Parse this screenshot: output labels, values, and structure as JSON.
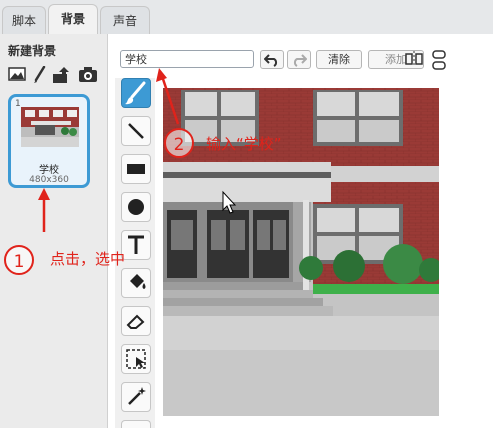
{
  "tabs": [
    {
      "label": "脚本"
    },
    {
      "label": "背景"
    },
    {
      "label": "声音"
    }
  ],
  "sidebar": {
    "new_backdrop_label": "新建背景",
    "source_icons": [
      "image-library-icon",
      "paint-brush-icon",
      "upload-icon",
      "camera-icon"
    ],
    "backdrop": {
      "index": "1",
      "name": "学校",
      "size": "480x360"
    }
  },
  "editor": {
    "name_input_value": "学校",
    "clear_label": "清除",
    "add_label": "添加",
    "toolbar_icons": [
      "undo-icon",
      "redo-icon",
      "flip-horizontal-icon",
      "flip-vertical-icon"
    ],
    "tools": [
      "brush-icon",
      "line-icon",
      "rectangle-icon",
      "ellipse-icon",
      "text-icon",
      "fill-icon",
      "eraser-icon",
      "select-icon",
      "magic-wand-icon",
      "stamp-icon"
    ]
  },
  "annotations": {
    "step1_number": "1",
    "step1_text": "点击，选中",
    "step2_number": "2",
    "step2_text": "输入“学校”"
  },
  "colors": {
    "accent": "#3d9ad4",
    "annotation": "#e0231b",
    "brick": "#9a3a36"
  }
}
